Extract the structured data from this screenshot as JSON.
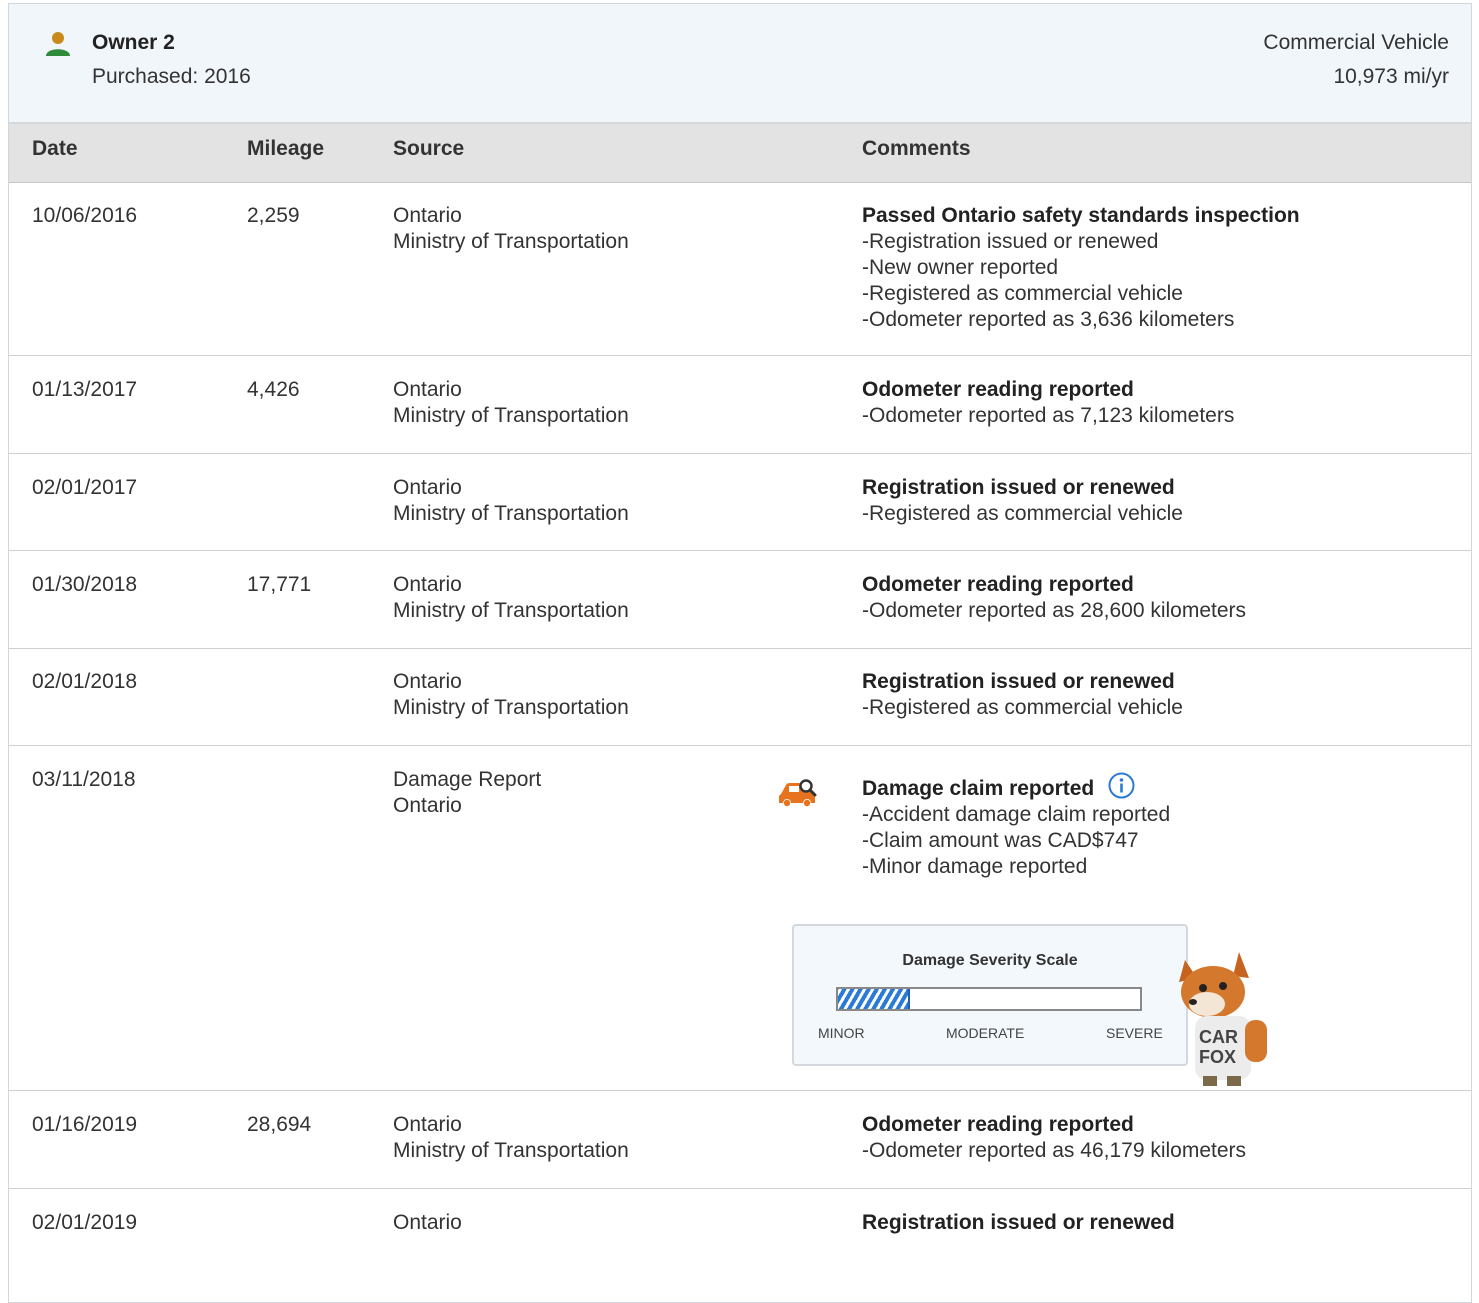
{
  "owner": {
    "name": "Owner 2",
    "purchased": "Purchased: 2016",
    "vehicle_type": "Commercial Vehicle",
    "miles_per_year": "10,973 mi/yr",
    "icon": "person-icon"
  },
  "columns": {
    "date": "Date",
    "mileage": "Mileage",
    "source": "Source",
    "comments": "Comments"
  },
  "rows": [
    {
      "date": "10/06/2016",
      "mileage": "2,259",
      "source_line1": "Ontario",
      "source_line2": "Ministry of Transportation",
      "comment_title": "Passed Ontario safety standards inspection",
      "details": [
        "Registration issued or renewed",
        "New owner reported",
        "Registered as commercial vehicle",
        "Odometer reported as 3,636 kilometers"
      ]
    },
    {
      "date": "01/13/2017",
      "mileage": "4,426",
      "source_line1": "Ontario",
      "source_line2": "Ministry of Transportation",
      "comment_title": "Odometer reading reported",
      "details": [
        "Odometer reported as 7,123 kilometers"
      ]
    },
    {
      "date": "02/01/2017",
      "mileage": "",
      "source_line1": "Ontario",
      "source_line2": "Ministry of Transportation",
      "comment_title": "Registration issued or renewed",
      "details": [
        "Registered as commercial vehicle"
      ]
    },
    {
      "date": "01/30/2018",
      "mileage": "17,771",
      "source_line1": "Ontario",
      "source_line2": "Ministry of Transportation",
      "comment_title": "Odometer reading reported",
      "details": [
        "Odometer reported as 28,600 kilometers"
      ]
    },
    {
      "date": "02/01/2018",
      "mileage": "",
      "source_line1": "Ontario",
      "source_line2": "Ministry of Transportation",
      "comment_title": "Registration issued or renewed",
      "details": [
        "Registered as commercial vehicle"
      ]
    },
    {
      "date": "03/11/2018",
      "mileage": "",
      "source_line1": "Damage Report",
      "source_line2": "Ontario",
      "comment_title": "Damage claim reported",
      "details": [
        "Accident damage claim reported",
        "Claim amount was CAD$747",
        "Minor damage reported"
      ],
      "icon": "damage-search-icon",
      "info_icon": "info-icon",
      "severity": {
        "title": "Damage Severity Scale",
        "level_fraction": 0.24,
        "labels": [
          "MINOR",
          "MODERATE",
          "SEVERE"
        ],
        "fill_color": "#2a7bd6"
      },
      "mascot_text_line1": "CAR",
      "mascot_text_line2": "FOX"
    },
    {
      "date": "01/16/2019",
      "mileage": "28,694",
      "source_line1": "Ontario",
      "source_line2": "Ministry of Transportation",
      "comment_title": "Odometer reading reported",
      "details": [
        "Odometer reported as 46,179 kilometers"
      ]
    },
    {
      "date": "02/01/2019",
      "mileage": "",
      "source_line1": "Ontario",
      "source_line2": "",
      "comment_title": "Registration issued or renewed",
      "details": []
    }
  ],
  "colors": {
    "header_bg": "#f1f6fb",
    "column_header_bg": "#e3e3e3",
    "owner_icon": "#2e8b3a",
    "damage_icon": "#e8731e",
    "info_icon": "#2a7bd6"
  }
}
